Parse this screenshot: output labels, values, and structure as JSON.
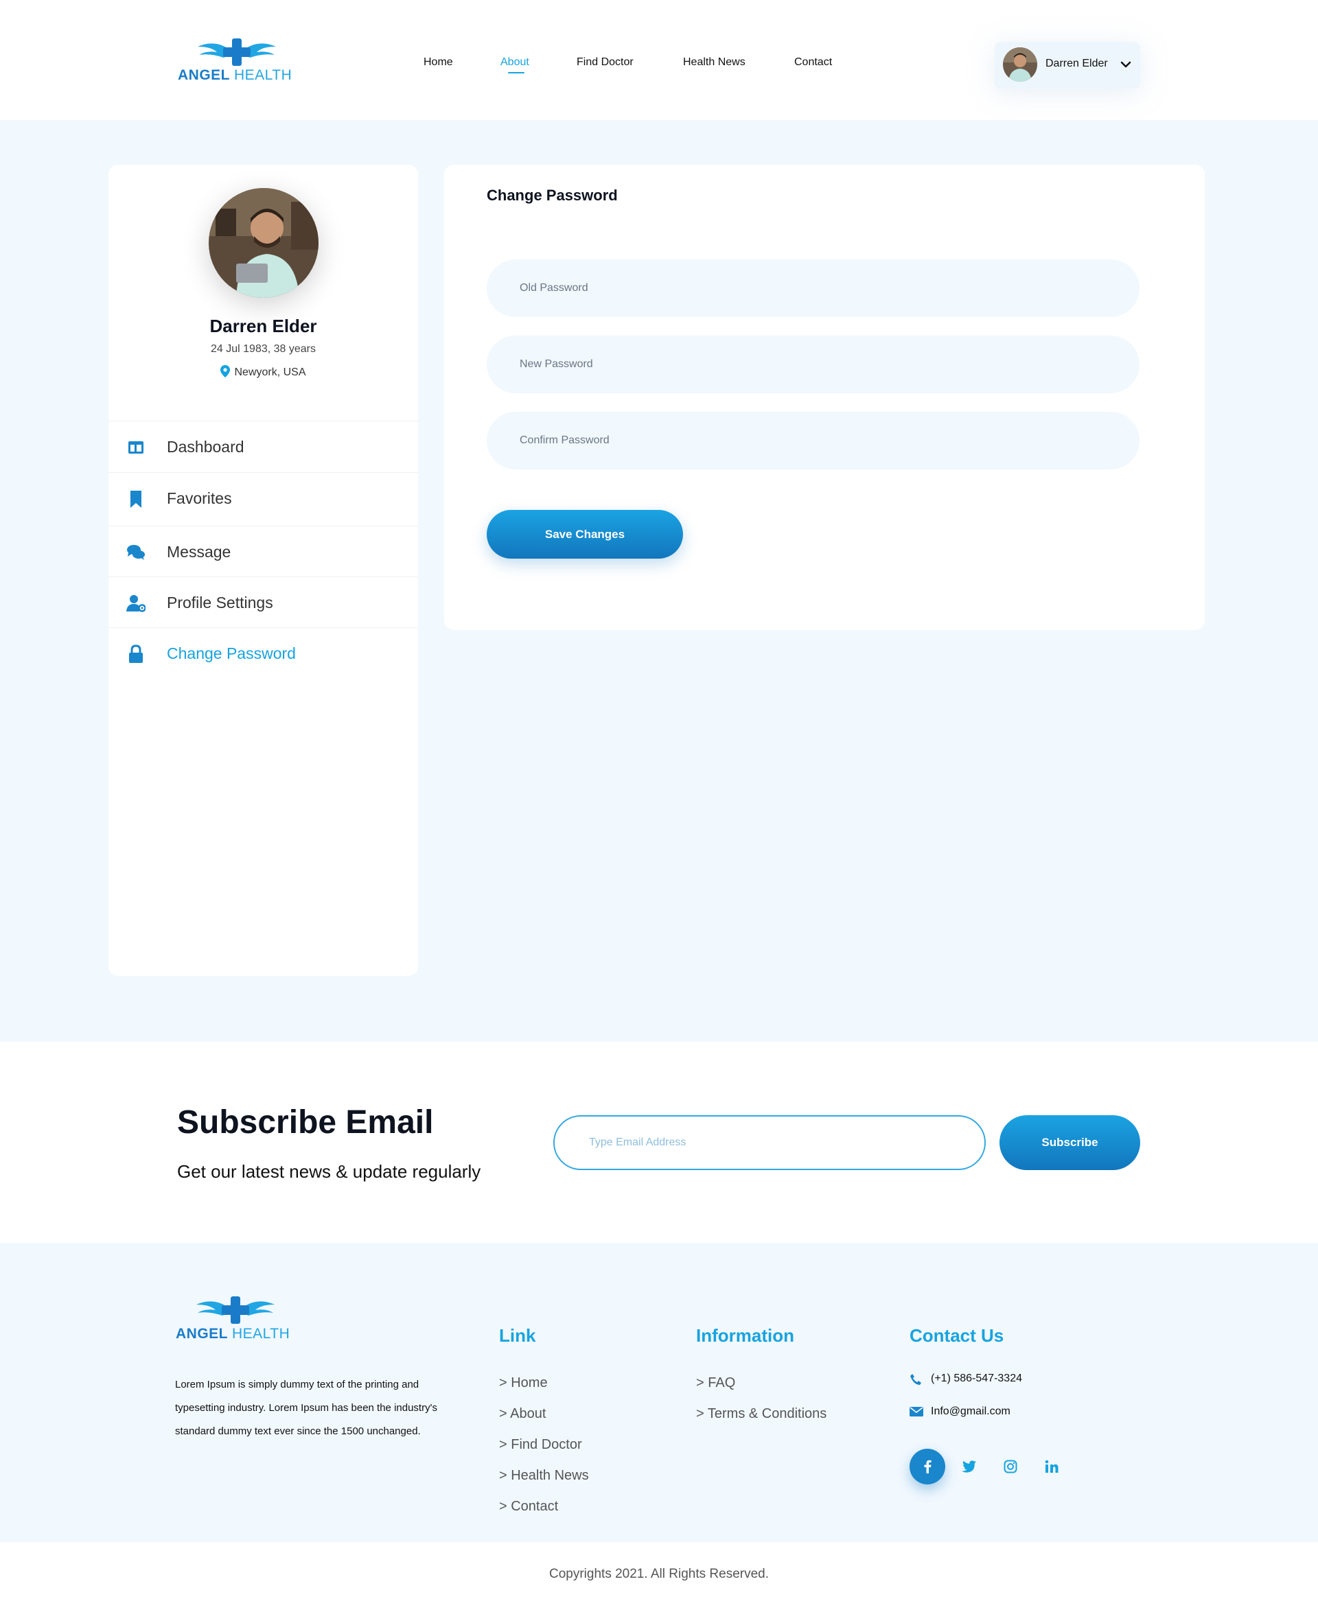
{
  "brand": {
    "name_part1": "ANGEL",
    "name_part2": "HEALTH"
  },
  "nav": {
    "items": [
      "Home",
      "About",
      "Find Doctor",
      "Health News",
      "Contact"
    ],
    "active": "About"
  },
  "user_menu": {
    "name": "Darren Elder",
    "chevron_icon": "chevron-down-icon"
  },
  "profile": {
    "name": "Darren Elder",
    "dob": "24 Jul 1983, 38 years",
    "location": "Newyork, USA"
  },
  "sidebar": {
    "items": [
      {
        "label": "Dashboard",
        "icon": "dashboard-icon"
      },
      {
        "label": "Favorites",
        "icon": "bookmark-icon"
      },
      {
        "label": "Message",
        "icon": "chat-icon"
      },
      {
        "label": "Profile Settings",
        "icon": "user-settings-icon"
      },
      {
        "label": "Change Password",
        "icon": "lock-icon",
        "active": true
      }
    ]
  },
  "change_password": {
    "title": "Change Password",
    "old_placeholder": "Old Password",
    "new_placeholder": "New Password",
    "confirm_placeholder": "Confirm Password",
    "save_label": "Save Changes"
  },
  "subscribe": {
    "title": "Subscribe Email",
    "description": "Get our latest news & update regularly",
    "placeholder": "Type Email Address",
    "button": "Subscribe"
  },
  "footer": {
    "about": "Lorem Ipsum is simply dummy text of the printing and typesetting industry. Lorem Ipsum has been the industry's standard dummy text ever since the 1500 unchanged.",
    "link_head": "Link",
    "links": [
      "> Home",
      "> About",
      "> Find Doctor",
      "> Health News",
      "> Contact"
    ],
    "info_head": "Information",
    "info_links": [
      "> FAQ",
      "> Terms & Conditions"
    ],
    "contact_head": "Contact Us",
    "phone": "(+1) 586-547-3324",
    "email": "Info@gmail.com",
    "social": [
      "facebook-icon",
      "twitter-icon",
      "instagram-icon",
      "linkedin-icon"
    ],
    "copyright": "Copyrights 2021. All Rights Reserved."
  },
  "colors": {
    "accent": "#17a3df",
    "accent_dark": "#1276bd",
    "bg_light": "#f1f8fe"
  }
}
